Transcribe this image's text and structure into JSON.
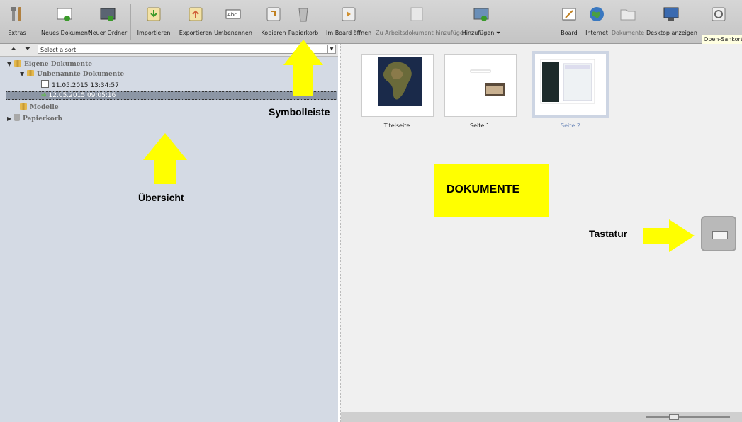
{
  "toolbar": {
    "extras": "Extras",
    "new_document": "Neues Dokument",
    "new_folder": "Neuer Ordner",
    "import": "Importieren",
    "export": "Exportieren",
    "rename": "Umbenennen",
    "copy": "Kopieren",
    "trash": "Papierkorb",
    "open_in_board": "Im Board öffnen",
    "add_to_working_doc": "Zu Arbeitsdokument hinzufügen",
    "add": "Hinzufügen",
    "board": "Board",
    "internet": "Internet",
    "documents": "Dokumente",
    "show_desktop": "Desktop anzeigen",
    "tooltip": "Open-Sankoré"
  },
  "sort": {
    "placeholder": "Select a sort"
  },
  "tree": {
    "my_documents": "Eigene Dokumente",
    "unnamed_documents": "Unbenannte Dokumente",
    "doc1": "11.05.2015 13:34:57",
    "doc2": "12.05.2015 09:05:16",
    "models": "Modelle",
    "trash": "Papierkorb"
  },
  "thumbnails": [
    {
      "label": "Titelseite",
      "selected": false
    },
    {
      "label": "Seite 1",
      "selected": false
    },
    {
      "label": "Seite 2",
      "selected": true
    }
  ],
  "annotations": {
    "toolbar_label": "Symbolleiste",
    "overview_label": "Übersicht",
    "documents_label": "DOKUMENTE",
    "keyboard_label": "Tastatur"
  },
  "colors": {
    "highlight_yellow": "#ffff00",
    "panel_left": "#d4dae4",
    "panel_right": "#f0f0f0"
  }
}
